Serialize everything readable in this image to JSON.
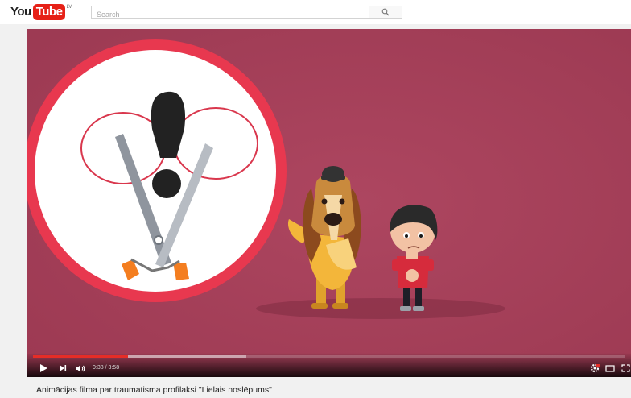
{
  "masthead": {
    "logo_you": "You",
    "logo_tube": "Tube",
    "logo_country": "LV",
    "search_placeholder": "Search",
    "search_icon": "magnifier-icon"
  },
  "player": {
    "time_current": "0:38",
    "time_separator": " / ",
    "time_total": "3:58",
    "time_display": "0:38 / 3:58",
    "played_fraction": 0.16,
    "loaded_fraction": 0.36,
    "icons": [
      "play-icon",
      "next-icon",
      "volume-icon",
      "settings-icon",
      "theater-mode-icon",
      "fullscreen-icon"
    ],
    "colors": {
      "progress": "#e52d27",
      "background_scene": "#a63e58"
    }
  },
  "video": {
    "title": "Animācijas filma par traumatisma profilaksi \"Lielais noslēpums\""
  }
}
